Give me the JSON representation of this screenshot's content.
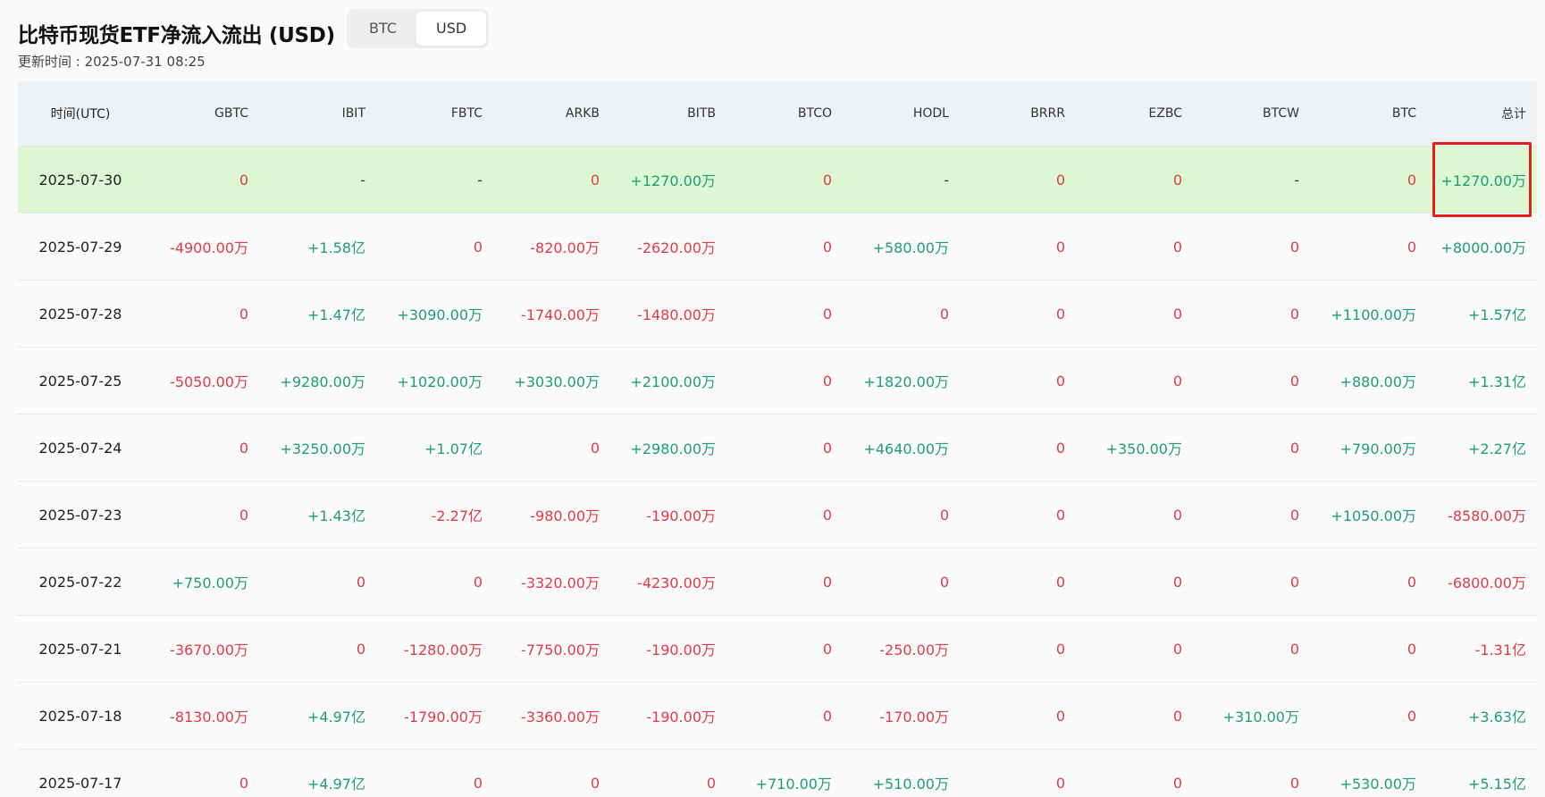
{
  "header": {
    "title": "比特币现货ETF净流入流出 (USD)",
    "toggle": [
      "BTC",
      "USD"
    ],
    "active_toggle": "USD",
    "updated": "更新时间 : 2025-07-31 08:25"
  },
  "table": {
    "columns": [
      "时间(UTC)",
      "GBTC",
      "IBIT",
      "FBTC",
      "ARKB",
      "BITB",
      "BTCO",
      "HODL",
      "BRRR",
      "EZBC",
      "BTCW",
      "BTC",
      "总计"
    ],
    "rows": [
      {
        "date": "2025-07-30",
        "values": [
          "0",
          "-",
          "-",
          "0",
          "+1270.00万",
          "0",
          "-",
          "0",
          "0",
          "-",
          "0",
          "+1270.00万"
        ],
        "highlight": true
      },
      {
        "date": "2025-07-29",
        "values": [
          "-4900.00万",
          "+1.58亿",
          "0",
          "-820.00万",
          "-2620.00万",
          "0",
          "+580.00万",
          "0",
          "0",
          "0",
          "0",
          "+8000.00万"
        ]
      },
      {
        "date": "2025-07-28",
        "values": [
          "0",
          "+1.47亿",
          "+3090.00万",
          "-1740.00万",
          "-1480.00万",
          "0",
          "0",
          "0",
          "0",
          "0",
          "+1100.00万",
          "+1.57亿"
        ]
      },
      {
        "date": "2025-07-25",
        "values": [
          "-5050.00万",
          "+9280.00万",
          "+1020.00万",
          "+3030.00万",
          "+2100.00万",
          "0",
          "+1820.00万",
          "0",
          "0",
          "0",
          "+880.00万",
          "+1.31亿"
        ]
      },
      {
        "date": "2025-07-24",
        "values": [
          "0",
          "+3250.00万",
          "+1.07亿",
          "0",
          "+2980.00万",
          "0",
          "+4640.00万",
          "0",
          "+350.00万",
          "0",
          "+790.00万",
          "+2.27亿"
        ]
      },
      {
        "date": "2025-07-23",
        "values": [
          "0",
          "+1.43亿",
          "-2.27亿",
          "-980.00万",
          "-190.00万",
          "0",
          "0",
          "0",
          "0",
          "0",
          "+1050.00万",
          "-8580.00万"
        ]
      },
      {
        "date": "2025-07-22",
        "values": [
          "+750.00万",
          "0",
          "0",
          "-3320.00万",
          "-4230.00万",
          "0",
          "0",
          "0",
          "0",
          "0",
          "0",
          "-6800.00万"
        ]
      },
      {
        "date": "2025-07-21",
        "values": [
          "-3670.00万",
          "0",
          "-1280.00万",
          "-7750.00万",
          "-190.00万",
          "0",
          "-250.00万",
          "0",
          "0",
          "0",
          "0",
          "-1.31亿"
        ]
      },
      {
        "date": "2025-07-18",
        "values": [
          "-8130.00万",
          "+4.97亿",
          "-1790.00万",
          "-3360.00万",
          "-190.00万",
          "0",
          "-170.00万",
          "0",
          "0",
          "+310.00万",
          "0",
          "+3.63亿"
        ]
      },
      {
        "date": "2025-07-17",
        "values": [
          "0",
          "+4.97亿",
          "0",
          "0",
          "0",
          "+710.00万",
          "+510.00万",
          "0",
          "0",
          "0",
          "+530.00万",
          "+5.15亿"
        ]
      }
    ]
  },
  "colors": {
    "positive": "#1e9e74",
    "negative": "#e03b47",
    "highlight_row": "#dcf8d3",
    "header_bg": "#eff2f5",
    "annotation_box": "#e21f1f"
  }
}
